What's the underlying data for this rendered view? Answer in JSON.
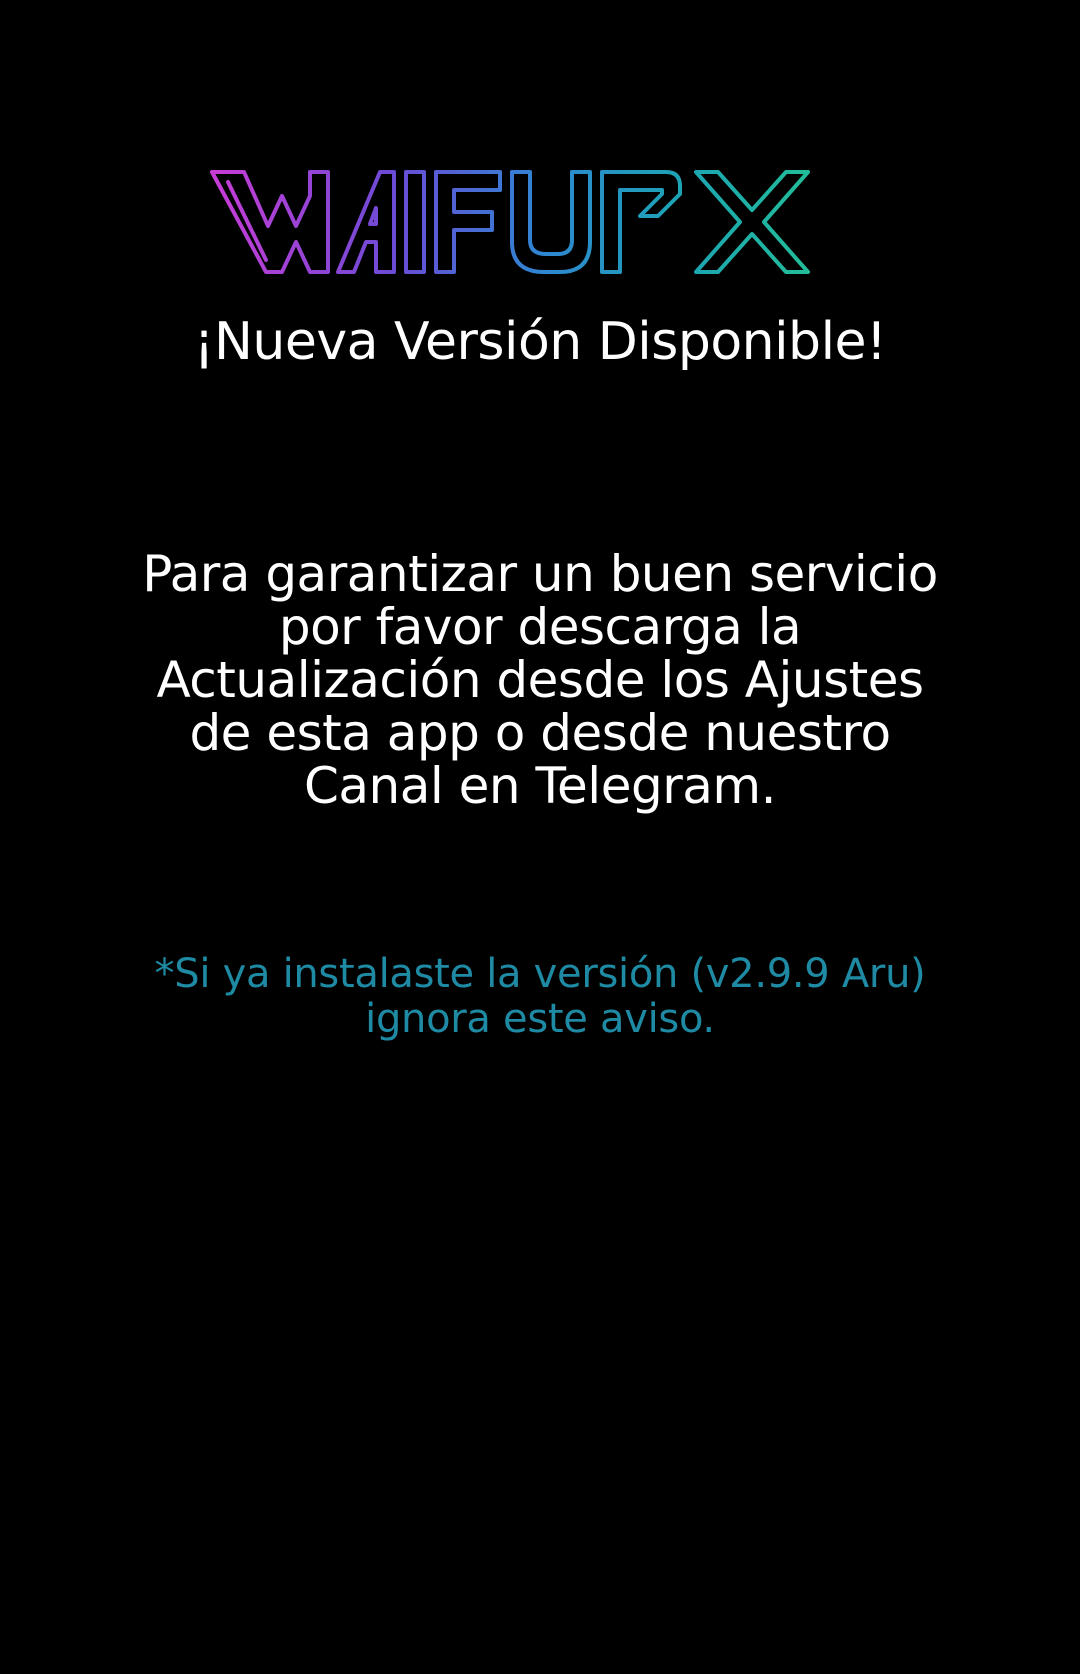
{
  "app": {
    "logo_text": "WAIFUFX",
    "logo_colors": [
      "#c23bd4",
      "#6a4bd6",
      "#2f8fd0",
      "#1fa9b5",
      "#22c48f"
    ]
  },
  "dialog": {
    "title": "¡Nueva Versión Disponible!",
    "message": "Para garantizar un buen servicio por favor descarga la Actualización desde los Ajustes de esta app o desde nuestro Canal en Telegram.",
    "notice": "*Si ya instalaste la versión (v2.9.9 Aru) ignora este aviso."
  },
  "colors": {
    "background": "#000000",
    "title": "#ffffff",
    "message": "#ffffff",
    "notice": "#1f8aa3"
  }
}
